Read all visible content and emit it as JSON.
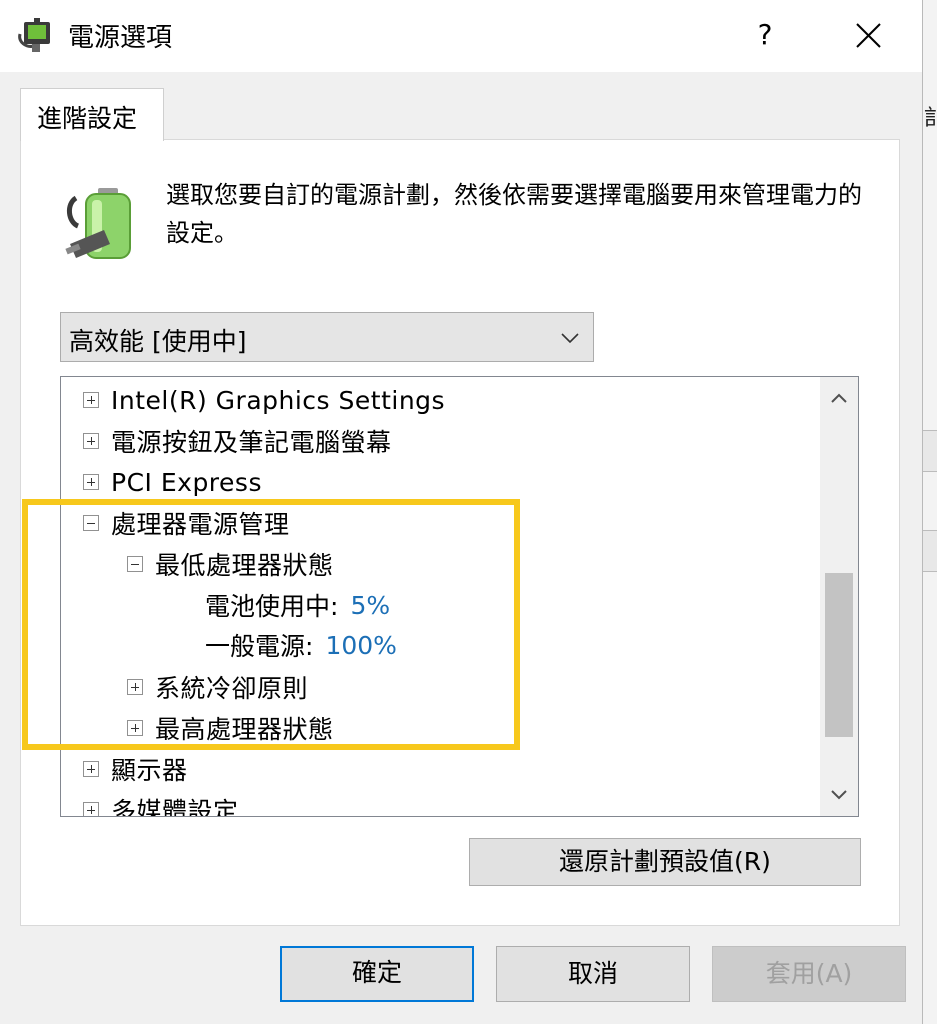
{
  "window": {
    "title": "電源選項",
    "help_label": "?",
    "icon": "power-options-icon"
  },
  "tab": {
    "label": "進階設定"
  },
  "description": "選取您要自訂的電源計劃，然後依需要選擇電腦要用來管理電力的設定。",
  "plan_select": {
    "value": "高效能 [使用中]"
  },
  "tree": {
    "items": [
      {
        "label": "Intel(R) Graphics Settings",
        "state": "collapsed"
      },
      {
        "label": "電源按鈕及筆記電腦螢幕",
        "state": "collapsed"
      },
      {
        "label": "PCI Express",
        "state": "collapsed"
      },
      {
        "label": "處理器電源管理",
        "state": "expanded"
      },
      {
        "label": "最低處理器狀態",
        "state": "expanded"
      },
      {
        "label": "系統冷卻原則",
        "state": "collapsed"
      },
      {
        "label": "最高處理器狀態",
        "state": "collapsed"
      },
      {
        "label": "顯示器",
        "state": "collapsed"
      },
      {
        "label": "多媒體設定",
        "state": "collapsed"
      }
    ],
    "settings": [
      {
        "label": "電池使用中:",
        "value": "5%"
      },
      {
        "label": "一般電源:",
        "value": "100%"
      }
    ]
  },
  "buttons": {
    "restore": "還原計劃預設值(R)",
    "ok": "確定",
    "cancel": "取消",
    "apply": "套用(A)"
  },
  "colors": {
    "value_link": "#1c6fb6",
    "highlight_border": "#f7c81c",
    "default_button_border": "#0078d7"
  }
}
